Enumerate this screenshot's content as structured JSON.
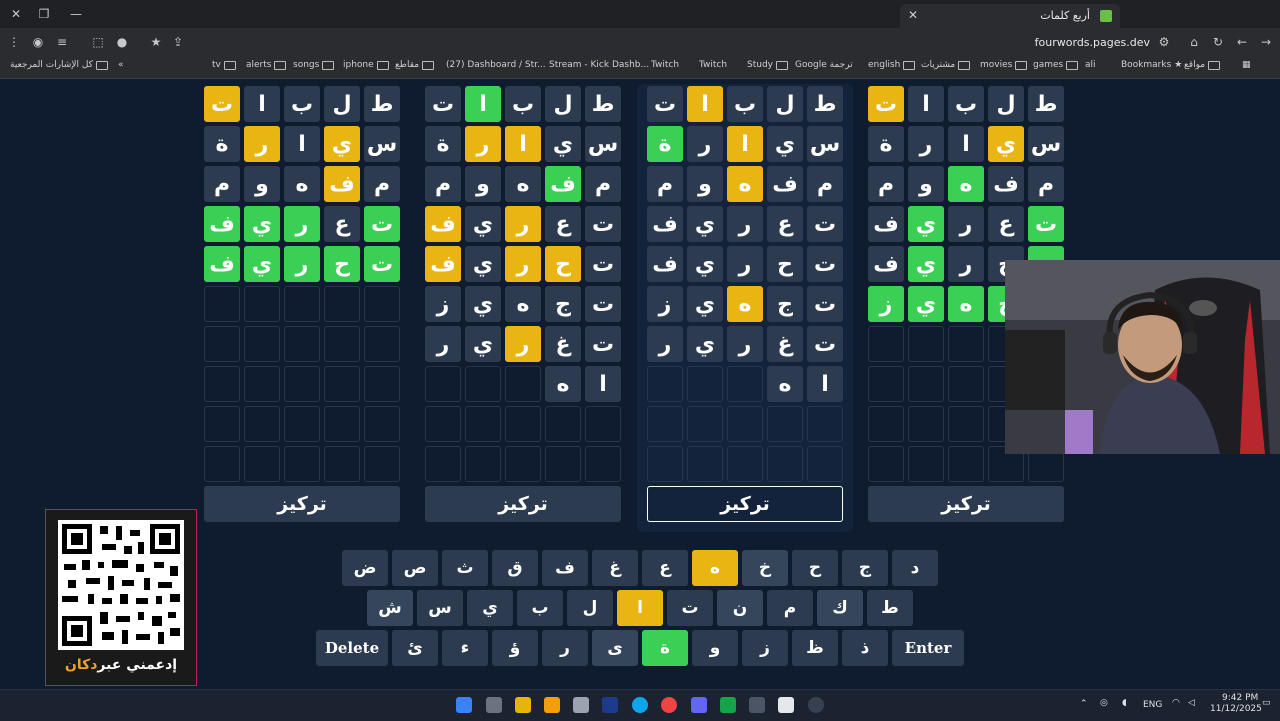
{
  "browser": {
    "tab_title": "أربع كلمات",
    "url": "fourwords.pages.dev",
    "bookmarks_left": "كل الإشارات المرجعية",
    "bookmarks": [
      "tv",
      "alerts",
      "songs",
      "iphone",
      "مقاطع",
      "(27) Dashboard / Str...",
      "Stream - Kick Dashb...",
      "Twitch",
      "Twitch",
      "Study",
      "Google ترجمة",
      "english",
      "مشتريات",
      "movies",
      "games",
      "ali",
      "Bookmarks",
      "مواقع"
    ]
  },
  "boards": [
    {
      "rows": [
        [
          [
            "ت",
            "y"
          ],
          [
            "ا",
            "n"
          ],
          [
            "ب",
            "n"
          ],
          [
            "ل",
            "n"
          ],
          [
            "ط",
            "n"
          ]
        ],
        [
          [
            "ة",
            "n"
          ],
          [
            "ر",
            "y"
          ],
          [
            "ا",
            "n"
          ],
          [
            "ي",
            "y"
          ],
          [
            "س",
            "n"
          ]
        ],
        [
          [
            "م",
            "n"
          ],
          [
            "و",
            "n"
          ],
          [
            "ه",
            "n"
          ],
          [
            "ف",
            "y"
          ],
          [
            "م",
            "n"
          ]
        ],
        [
          [
            "ف",
            "g"
          ],
          [
            "ي",
            "g"
          ],
          [
            "ر",
            "g"
          ],
          [
            "ع",
            "n"
          ],
          [
            "ت",
            "g"
          ]
        ],
        [
          [
            "ف",
            "g"
          ],
          [
            "ي",
            "g"
          ],
          [
            "ر",
            "g"
          ],
          [
            "ح",
            "g"
          ],
          [
            "ت",
            "g"
          ]
        ],
        [
          [
            "",
            "e"
          ],
          [
            "",
            "e"
          ],
          [
            "",
            "e"
          ],
          [
            "",
            "e"
          ],
          [
            "",
            "e"
          ]
        ],
        [
          [
            "",
            "e"
          ],
          [
            "",
            "e"
          ],
          [
            "",
            "e"
          ],
          [
            "",
            "e"
          ],
          [
            "",
            "e"
          ]
        ],
        [
          [
            "",
            "e"
          ],
          [
            "",
            "e"
          ],
          [
            "",
            "e"
          ],
          [
            "",
            "e"
          ],
          [
            "",
            "e"
          ]
        ],
        [
          [
            "",
            "e"
          ],
          [
            "",
            "e"
          ],
          [
            "",
            "e"
          ],
          [
            "",
            "e"
          ],
          [
            "",
            "e"
          ]
        ],
        [
          [
            "",
            "e"
          ],
          [
            "",
            "e"
          ],
          [
            "",
            "e"
          ],
          [
            "",
            "e"
          ],
          [
            "",
            "e"
          ]
        ]
      ],
      "focus": "تركيز"
    },
    {
      "rows": [
        [
          [
            "ت",
            "n"
          ],
          [
            "ا",
            "g"
          ],
          [
            "ب",
            "n"
          ],
          [
            "ل",
            "n"
          ],
          [
            "ط",
            "n"
          ]
        ],
        [
          [
            "ة",
            "n"
          ],
          [
            "ر",
            "y"
          ],
          [
            "ا",
            "y"
          ],
          [
            "ي",
            "n"
          ],
          [
            "س",
            "n"
          ]
        ],
        [
          [
            "م",
            "n"
          ],
          [
            "و",
            "n"
          ],
          [
            "ه",
            "n"
          ],
          [
            "ف",
            "g"
          ],
          [
            "م",
            "n"
          ]
        ],
        [
          [
            "ف",
            "y"
          ],
          [
            "ي",
            "n"
          ],
          [
            "ر",
            "y"
          ],
          [
            "ع",
            "n"
          ],
          [
            "ت",
            "n"
          ]
        ],
        [
          [
            "ف",
            "y"
          ],
          [
            "ي",
            "n"
          ],
          [
            "ر",
            "y"
          ],
          [
            "ح",
            "y"
          ],
          [
            "ت",
            "n"
          ]
        ],
        [
          [
            "ز",
            "n"
          ],
          [
            "ي",
            "n"
          ],
          [
            "ه",
            "n"
          ],
          [
            "ج",
            "n"
          ],
          [
            "ت",
            "n"
          ]
        ],
        [
          [
            "ر",
            "n"
          ],
          [
            "ي",
            "n"
          ],
          [
            "ر",
            "y"
          ],
          [
            "غ",
            "n"
          ],
          [
            "ت",
            "n"
          ]
        ],
        [
          [
            "",
            "e"
          ],
          [
            "",
            "e"
          ],
          [
            "",
            "e"
          ],
          [
            "ه",
            "n"
          ],
          [
            "ا",
            "n"
          ]
        ],
        [
          [
            "",
            "e"
          ],
          [
            "",
            "e"
          ],
          [
            "",
            "e"
          ],
          [
            "",
            "e"
          ],
          [
            "",
            "e"
          ]
        ],
        [
          [
            "",
            "e"
          ],
          [
            "",
            "e"
          ],
          [
            "",
            "e"
          ],
          [
            "",
            "e"
          ],
          [
            "",
            "e"
          ]
        ]
      ],
      "focus": "تركيز"
    },
    {
      "rows": [
        [
          [
            "ت",
            "n"
          ],
          [
            "ا",
            "y"
          ],
          [
            "ب",
            "n"
          ],
          [
            "ل",
            "n"
          ],
          [
            "ط",
            "n"
          ]
        ],
        [
          [
            "ة",
            "g"
          ],
          [
            "ر",
            "n"
          ],
          [
            "ا",
            "y"
          ],
          [
            "ي",
            "n"
          ],
          [
            "س",
            "n"
          ]
        ],
        [
          [
            "م",
            "n"
          ],
          [
            "و",
            "n"
          ],
          [
            "ه",
            "y"
          ],
          [
            "ف",
            "n"
          ],
          [
            "م",
            "n"
          ]
        ],
        [
          [
            "ف",
            "n"
          ],
          [
            "ي",
            "n"
          ],
          [
            "ر",
            "n"
          ],
          [
            "ع",
            "n"
          ],
          [
            "ت",
            "n"
          ]
        ],
        [
          [
            "ف",
            "n"
          ],
          [
            "ي",
            "n"
          ],
          [
            "ر",
            "n"
          ],
          [
            "ح",
            "n"
          ],
          [
            "ت",
            "n"
          ]
        ],
        [
          [
            "ز",
            "n"
          ],
          [
            "ي",
            "n"
          ],
          [
            "ه",
            "y"
          ],
          [
            "ج",
            "n"
          ],
          [
            "ت",
            "n"
          ]
        ],
        [
          [
            "ر",
            "n"
          ],
          [
            "ي",
            "n"
          ],
          [
            "ر",
            "n"
          ],
          [
            "غ",
            "n"
          ],
          [
            "ت",
            "n"
          ]
        ],
        [
          [
            "",
            "e"
          ],
          [
            "",
            "e"
          ],
          [
            "",
            "e"
          ],
          [
            "ه",
            "n"
          ],
          [
            "ا",
            "n"
          ]
        ],
        [
          [
            "",
            "e"
          ],
          [
            "",
            "e"
          ],
          [
            "",
            "e"
          ],
          [
            "",
            "e"
          ],
          [
            "",
            "e"
          ]
        ],
        [
          [
            "",
            "e"
          ],
          [
            "",
            "e"
          ],
          [
            "",
            "e"
          ],
          [
            "",
            "e"
          ],
          [
            "",
            "e"
          ]
        ]
      ],
      "focus": "تركيز"
    },
    {
      "rows": [
        [
          [
            "ت",
            "y"
          ],
          [
            "ا",
            "n"
          ],
          [
            "ب",
            "n"
          ],
          [
            "ل",
            "n"
          ],
          [
            "ط",
            "n"
          ]
        ],
        [
          [
            "ة",
            "n"
          ],
          [
            "ر",
            "n"
          ],
          [
            "ا",
            "n"
          ],
          [
            "ي",
            "y"
          ],
          [
            "س",
            "n"
          ]
        ],
        [
          [
            "م",
            "n"
          ],
          [
            "و",
            "n"
          ],
          [
            "ه",
            "g"
          ],
          [
            "ف",
            "n"
          ],
          [
            "م",
            "n"
          ]
        ],
        [
          [
            "ف",
            "n"
          ],
          [
            "ي",
            "g"
          ],
          [
            "ر",
            "n"
          ],
          [
            "ع",
            "n"
          ],
          [
            "ت",
            "g"
          ]
        ],
        [
          [
            "ف",
            "n"
          ],
          [
            "ي",
            "g"
          ],
          [
            "ر",
            "n"
          ],
          [
            "ح",
            "n"
          ],
          [
            "ت",
            "g"
          ]
        ],
        [
          [
            "ز",
            "g"
          ],
          [
            "ي",
            "g"
          ],
          [
            "ه",
            "g"
          ],
          [
            "ج",
            "g"
          ],
          [
            "ت",
            "n"
          ]
        ],
        [
          [
            "",
            "e"
          ],
          [
            "",
            "e"
          ],
          [
            "",
            "e"
          ],
          [
            "",
            "e"
          ],
          [
            "",
            "e"
          ]
        ],
        [
          [
            "",
            "e"
          ],
          [
            "",
            "e"
          ],
          [
            "",
            "e"
          ],
          [
            "",
            "e"
          ],
          [
            "",
            "e"
          ]
        ],
        [
          [
            "",
            "e"
          ],
          [
            "",
            "e"
          ],
          [
            "",
            "e"
          ],
          [
            "",
            "e"
          ],
          [
            "",
            "e"
          ]
        ],
        [
          [
            "",
            "e"
          ],
          [
            "",
            "e"
          ],
          [
            "",
            "e"
          ],
          [
            "",
            "e"
          ],
          [
            "",
            "e"
          ]
        ]
      ],
      "focus": "تركيز"
    }
  ],
  "keyboard": {
    "row1": [
      [
        "ض",
        "n"
      ],
      [
        "ص",
        "n"
      ],
      [
        "ث",
        "n"
      ],
      [
        "ق",
        "n"
      ],
      [
        "ف",
        "n"
      ],
      [
        "غ",
        "n"
      ],
      [
        "ع",
        "n"
      ],
      [
        "ه",
        "y"
      ],
      [
        "خ",
        "d"
      ],
      [
        "ح",
        "n"
      ],
      [
        "ج",
        "n"
      ],
      [
        "د",
        "n"
      ]
    ],
    "row2": [
      [
        "ش",
        "d"
      ],
      [
        "س",
        "n"
      ],
      [
        "ي",
        "n"
      ],
      [
        "ب",
        "n"
      ],
      [
        "ل",
        "n"
      ],
      [
        "ا",
        "y"
      ],
      [
        "ت",
        "n"
      ],
      [
        "ن",
        "d"
      ],
      [
        "م",
        "n"
      ],
      [
        "ك",
        "d"
      ],
      [
        "ط",
        "n"
      ]
    ],
    "row3": [
      [
        "Delete",
        "w"
      ],
      [
        "ئ",
        "n"
      ],
      [
        "ء",
        "n"
      ],
      [
        "ؤ",
        "n"
      ],
      [
        "ر",
        "n"
      ],
      [
        "ى",
        "d"
      ],
      [
        "ة",
        "g"
      ],
      [
        "و",
        "n"
      ],
      [
        "ز",
        "n"
      ],
      [
        "ظ",
        "n"
      ],
      [
        "ذ",
        "n"
      ],
      [
        "Enter",
        "w"
      ]
    ]
  },
  "qr": {
    "label_a": "إدعمني عبر",
    "label_b": "دكان"
  },
  "taskbar": {
    "lang": "ENG",
    "time": "9:42 PM",
    "date": "11/12/2025"
  },
  "colors": {
    "correct": "#3ccf55",
    "present": "#e9b512",
    "absent": "#2d3b50",
    "background": "#0f1b2e"
  }
}
